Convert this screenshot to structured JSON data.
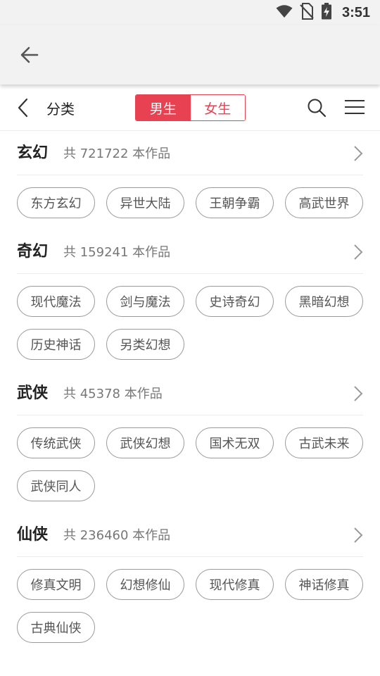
{
  "status_bar": {
    "time": "3:51"
  },
  "nav": {
    "title": "分类",
    "segments": {
      "male": "男生",
      "female": "女生"
    }
  },
  "categories": [
    {
      "name": "玄幻",
      "count": "共 721722 本作品",
      "tags": [
        "东方玄幻",
        "异世大陆",
        "王朝争霸",
        "高武世界"
      ]
    },
    {
      "name": "奇幻",
      "count": "共 159241 本作品",
      "tags": [
        "现代魔法",
        "剑与魔法",
        "史诗奇幻",
        "黑暗幻想",
        "历史神话",
        "另类幻想"
      ]
    },
    {
      "name": "武侠",
      "count": "共 45378 本作品",
      "tags": [
        "传统武侠",
        "武侠幻想",
        "国术无双",
        "古武未来",
        "武侠同人"
      ]
    },
    {
      "name": "仙侠",
      "count": "共 236460 本作品",
      "tags": [
        "修真文明",
        "幻想修仙",
        "现代修真",
        "神话修真",
        "古典仙侠"
      ]
    }
  ],
  "colors": {
    "accent": "#e84151",
    "app_bar_bg": "#f2f2f2",
    "tag_border": "#9a9a9a"
  },
  "icons": [
    "wifi-icon",
    "no-sim-icon",
    "battery-charging-icon",
    "arrow-back-icon",
    "chevron-left-icon",
    "search-icon",
    "menu-icon",
    "chevron-right-icon"
  ]
}
